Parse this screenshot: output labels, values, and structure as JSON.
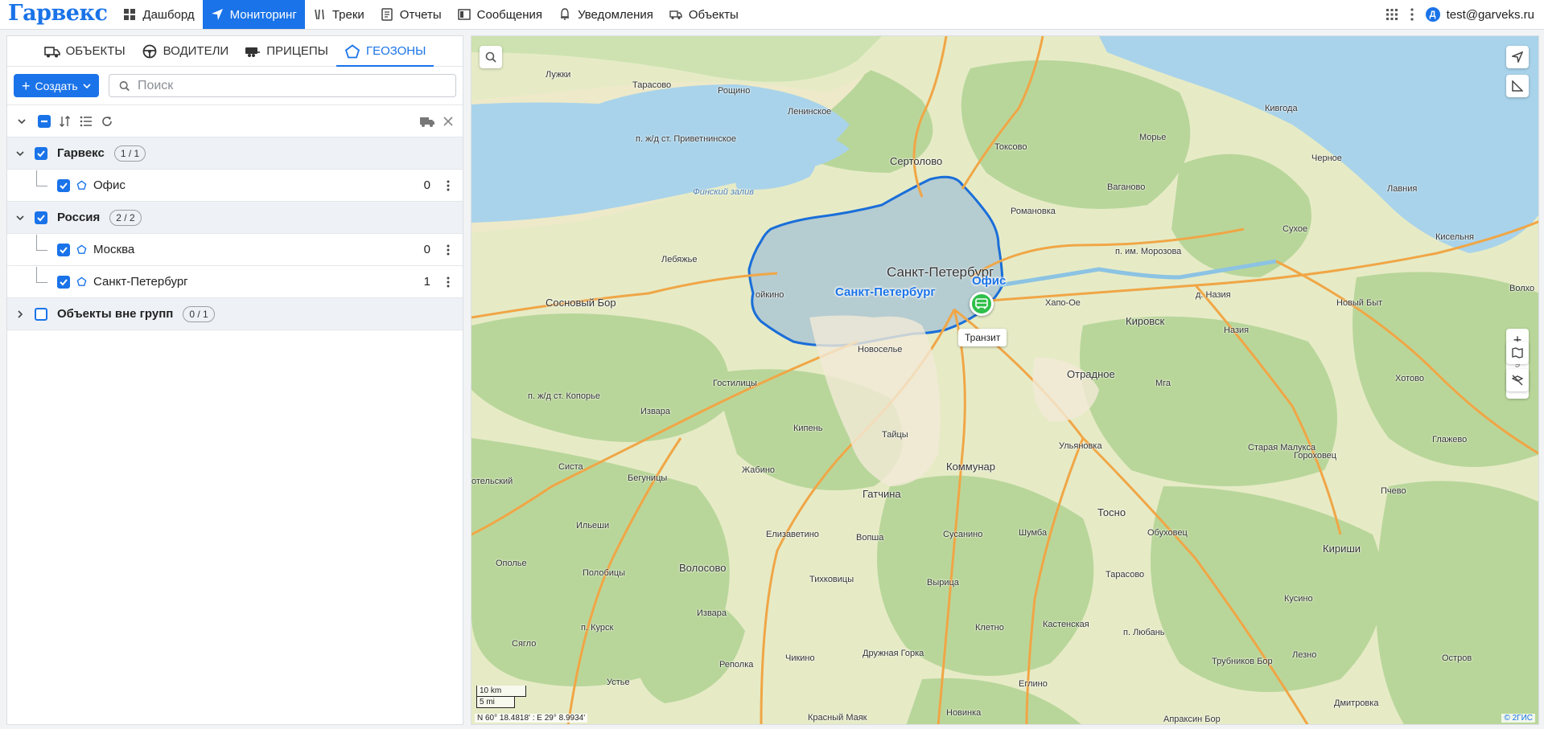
{
  "app": {
    "logo": "Гарвекс"
  },
  "nav": [
    {
      "label": "Дашборд",
      "icon": "dashboard-icon"
    },
    {
      "label": "Мониторинг",
      "icon": "navigation-arrow-icon",
      "active": true
    },
    {
      "label": "Треки",
      "icon": "tracks-icon"
    },
    {
      "label": "Отчеты",
      "icon": "report-icon"
    },
    {
      "label": "Сообщения",
      "icon": "messages-icon"
    },
    {
      "label": "Уведомления",
      "icon": "bell-icon"
    },
    {
      "label": "Объекты",
      "icon": "truck-icon"
    }
  ],
  "user": {
    "initial": "Д",
    "email": "test@garveks.ru"
  },
  "tabs": [
    {
      "label": "Объекты",
      "icon": "truck-icon"
    },
    {
      "label": "Водители",
      "icon": "steering-wheel-icon"
    },
    {
      "label": "Прицепы",
      "icon": "trailer-icon"
    },
    {
      "label": "Геозоны",
      "icon": "pentagon-icon",
      "active": true
    }
  ],
  "toolbar": {
    "create_label": "Создать",
    "search_placeholder": "Поиск"
  },
  "groups": [
    {
      "name": "Гарвекс",
      "badge": "1 / 1",
      "checked": true,
      "expanded": true,
      "items": [
        {
          "name": "Офис",
          "count": "0"
        }
      ]
    },
    {
      "name": "Россия",
      "badge": "2 / 2",
      "checked": true,
      "expanded": true,
      "items": [
        {
          "name": "Москва",
          "count": "0"
        },
        {
          "name": "Санкт-Петербург",
          "count": "1"
        }
      ]
    },
    {
      "name": "Объекты вне групп",
      "badge": "0 / 1",
      "checked": false,
      "expanded": false,
      "items": []
    }
  ],
  "map": {
    "geozone_labels": {
      "spb": "Санкт-Петербург",
      "office": "Офис"
    },
    "marker_tooltip": "Транзит",
    "zoom_level": "9",
    "scale_km": "10 km",
    "scale_mi": "5 mi",
    "coords": "N 60° 18.4818' : E 29° 8.9934'",
    "attribution": "© 2ГИС",
    "place_labels": {
      "luzhki": "Лужки",
      "tarasovo": "Тарасово",
      "roshchino": "Рощино",
      "leninskoe": "Ленинское",
      "privetninskoe": "п. ж/д ст. Приветнинское",
      "sertolovo": "Сертолово",
      "toksovo": "Токсово",
      "morye": "Морье",
      "kirovsk": "Кировск",
      "vaganovo": "Ваганово",
      "romanovka": "Романовка",
      "finsky_zaliv": "Финский залив",
      "lebyazhye": "Лебяжье",
      "sosnovy_bor": "Сосновый Бор",
      "spb_city": "Санкт-Петербург",
      "novoselye": "Новоселье",
      "khapo_oe": "Хапо-Ое",
      "otradnoe": "Отрадное",
      "im_morozova": "п. им. Морозова",
      "nazia_p": "д. Назия",
      "nazia": "Назия",
      "novy_byt": "Новый Быт",
      "gostilitsy": "Гостилицы",
      "koporye": "п. ж/д ст. Копорье",
      "izvara_n": "Извара",
      "kipen": "Кипень",
      "taitsy": "Тайцы",
      "ulyanovka": "Ульяновка",
      "mga": "Мга",
      "staraya_malukса": "Старая Малукса",
      "kommunar": "Коммунар",
      "sista": "Систа",
      "begunitsy": "Бегуницы",
      "zhabino": "Жабино",
      "gatchina": "Гатчина",
      "tosno": "Тосно",
      "ilyeshi": "Ильеши",
      "elizavetino": "Елизаветино",
      "vopsha": "Вопша",
      "susanino": "Сусанино",
      "shumba": "Шумба",
      "obukhovo": "Обуховец",
      "opole": "Ополье",
      "polobitsy": "Полобицы",
      "volosovo": "Волосово",
      "tikhkovitsy": "Тихковицы",
      "vyritsa": "Вырица",
      "tarasovo2": "Тарасово",
      "kursk": "п. Курск",
      "izvara_s": "Извара",
      "kletno": "Клетно",
      "kastenskaya": "Кастенская",
      "p_lyuban": "п. Любань",
      "syaglo": "Сягло",
      "chikino": "Чикино",
      "druzhnaya_gorka": "Дружная Горка",
      "repolka": "Реполка",
      "ustye": "Устье",
      "eglino": "Еглино",
      "trubnikov_bor": "Трубников Бор",
      "krasny_mayak": "Красный Маяк",
      "novinka": "Новинка",
      "apraksin_bor": "Апраксин Бор",
      "kirishi": "Кириши",
      "kivgoda": "Кивгода",
      "chernoe": "Черное",
      "lavniya": "Лавния",
      "sukhoe": "Сухое",
      "kiselnya": "Кисельня",
      "volkhov": "Волхо",
      "khotovo": "Хотово",
      "glazhevo": "Глажево",
      "gorokhovets": "Гороховец",
      "pchevo": "Пчево",
      "kusino": "Кусино",
      "lezno": "Лезно",
      "ostrov": "Остров",
      "dmitrovka": "Дмитровка",
      "oykino": "ойкино",
      "telsky": "отельский"
    }
  }
}
